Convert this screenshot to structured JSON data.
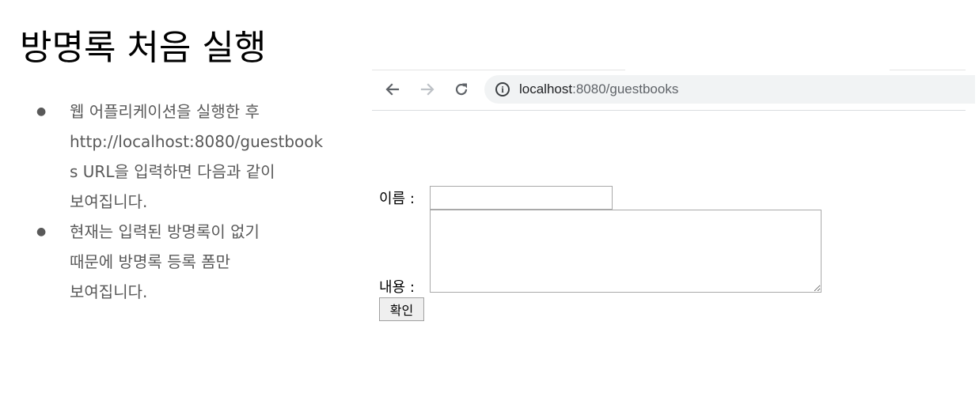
{
  "slide": {
    "title": "방명록 처음 실행",
    "bullets": [
      {
        "lines": [
          "웹 어플리케이션을 실행한 후",
          "http://localhost:8080/guestbook",
          "s URL을 입력하면 다음과 같이",
          "보여집니다."
        ]
      },
      {
        "lines": [
          "현재는 입력된 방명록이 없기",
          "때문에 방명록 등록 폼만",
          "보여집니다."
        ]
      }
    ]
  },
  "browser": {
    "back_icon": "arrow-left-icon",
    "forward_icon": "arrow-right-icon",
    "reload_icon": "reload-icon",
    "info_icon": "info-icon",
    "url_host": "localhost",
    "url_path": ":8080/guestbooks"
  },
  "form": {
    "name_label": "이름 :",
    "name_value": "",
    "content_label": "내용 :",
    "content_value": "",
    "submit_label": "확인"
  }
}
